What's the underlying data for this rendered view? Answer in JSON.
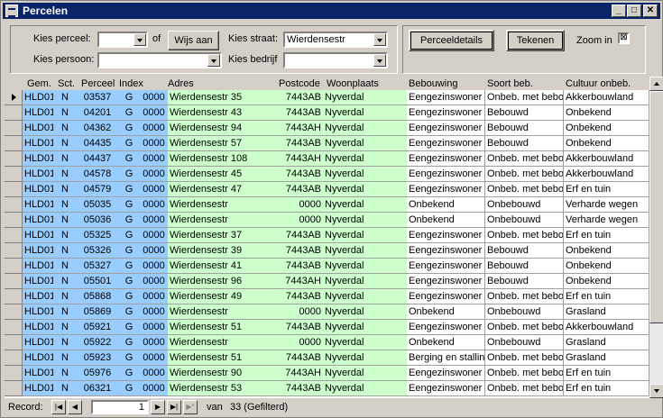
{
  "window": {
    "title": "Percelen"
  },
  "filters": {
    "perceel_label": "Kies perceel:",
    "perceel_value": "",
    "of_label": "of",
    "wijs_aan": "Wijs aan",
    "straat_label": "Kies straat:",
    "straat_value": "Wierdensestr",
    "persoon_label": "Kies persoon:",
    "persoon_value": "",
    "bedrijf_label": "Kies bedrijf",
    "bedrijf_value": ""
  },
  "actions": {
    "perceeldetails": "Perceeldetails",
    "tekenen": "Tekenen",
    "zoom_in_label": "Zoom in",
    "zoom_in_checked": "⊠"
  },
  "columns": [
    "Gem.",
    "Sct.",
    "Perceel",
    "Index",
    "Adres",
    "Postcode",
    "Woonplaats",
    "Bebouwing",
    "Soort beb.",
    "Cultuur onbeb."
  ],
  "rows": [
    [
      "HLD01",
      "N",
      "03537",
      "G",
      "0000",
      "Wierdensestr 35",
      "7443AB",
      "Nyverdal",
      "Eengezinswoner",
      "Onbeb. met bebo",
      "Akkerbouwland"
    ],
    [
      "HLD01",
      "N",
      "04201",
      "G",
      "0000",
      "Wierdensestr 43",
      "7443AB",
      "Nyverdal",
      "Eengezinswoner",
      "Bebouwd",
      "Onbekend"
    ],
    [
      "HLD01",
      "N",
      "04362",
      "G",
      "0000",
      "Wierdensestr 94",
      "7443AH",
      "Nyverdal",
      "Eengezinswoner",
      "Bebouwd",
      "Onbekend"
    ],
    [
      "HLD01",
      "N",
      "04435",
      "G",
      "0000",
      "Wierdensestr 57",
      "7443AB",
      "Nyverdal",
      "Eengezinswoner",
      "Bebouwd",
      "Onbekend"
    ],
    [
      "HLD01",
      "N",
      "04437",
      "G",
      "0000",
      "Wierdensestr 108",
      "7443AH",
      "Nyverdal",
      "Eengezinswoner",
      "Onbeb. met bebo",
      "Akkerbouwland"
    ],
    [
      "HLD01",
      "N",
      "04578",
      "G",
      "0000",
      "Wierdensestr 45",
      "7443AB",
      "Nyverdal",
      "Eengezinswoner",
      "Onbeb. met bebo",
      "Akkerbouwland"
    ],
    [
      "HLD01",
      "N",
      "04579",
      "G",
      "0000",
      "Wierdensestr 47",
      "7443AB",
      "Nyverdal",
      "Eengezinswoner",
      "Onbeb. met bebo",
      "Erf en tuin"
    ],
    [
      "HLD01",
      "N",
      "05035",
      "G",
      "0000",
      "Wierdensestr",
      "0000",
      "Nyverdal",
      "Onbekend",
      "Onbebouwd",
      "Verharde wegen"
    ],
    [
      "HLD01",
      "N",
      "05036",
      "G",
      "0000",
      "Wierdensestr",
      "0000",
      "Nyverdal",
      "Onbekend",
      "Onbebouwd",
      "Verharde wegen"
    ],
    [
      "HLD01",
      "N",
      "05325",
      "G",
      "0000",
      "Wierdensestr 37",
      "7443AB",
      "Nyverdal",
      "Eengezinswoner",
      "Onbeb. met bebo",
      "Erf en tuin"
    ],
    [
      "HLD01",
      "N",
      "05326",
      "G",
      "0000",
      "Wierdensestr 39",
      "7443AB",
      "Nyverdal",
      "Eengezinswoner",
      "Bebouwd",
      "Onbekend"
    ],
    [
      "HLD01",
      "N",
      "05327",
      "G",
      "0000",
      "Wierdensestr 41",
      "7443AB",
      "Nyverdal",
      "Eengezinswoner",
      "Bebouwd",
      "Onbekend"
    ],
    [
      "HLD01",
      "N",
      "05501",
      "G",
      "0000",
      "Wierdensestr 96",
      "7443AH",
      "Nyverdal",
      "Eengezinswoner",
      "Bebouwd",
      "Onbekend"
    ],
    [
      "HLD01",
      "N",
      "05868",
      "G",
      "0000",
      "Wierdensestr 49",
      "7443AB",
      "Nyverdal",
      "Eengezinswoner",
      "Onbeb. met bebo",
      "Erf en tuin"
    ],
    [
      "HLD01",
      "N",
      "05869",
      "G",
      "0000",
      "Wierdensestr",
      "0000",
      "Nyverdal",
      "Onbekend",
      "Onbebouwd",
      "Grasland"
    ],
    [
      "HLD01",
      "N",
      "05921",
      "G",
      "0000",
      "Wierdensestr 51",
      "7443AB",
      "Nyverdal",
      "Eengezinswoner",
      "Onbeb. met bebo",
      "Akkerbouwland"
    ],
    [
      "HLD01",
      "N",
      "05922",
      "G",
      "0000",
      "Wierdensestr",
      "0000",
      "Nyverdal",
      "Onbekend",
      "Onbebouwd",
      "Grasland"
    ],
    [
      "HLD01",
      "N",
      "05923",
      "G",
      "0000",
      "Wierdensestr 51",
      "7443AB",
      "Nyverdal",
      "Berging en stallin",
      "Onbeb. met bebo",
      "Grasland"
    ],
    [
      "HLD01",
      "N",
      "05976",
      "G",
      "0000",
      "Wierdensestr 90",
      "7443AH",
      "Nyverdal",
      "Eengezinswoner",
      "Onbeb. met bebo",
      "Erf en tuin"
    ],
    [
      "HLD01",
      "N",
      "06321",
      "G",
      "0000",
      "Wierdensestr 53",
      "7443AB",
      "Nyverdal",
      "Eengezinswoner",
      "Onbeb. met bebo",
      "Erf en tuin"
    ]
  ],
  "status": {
    "record_label": "Record:",
    "current": "1",
    "of_label": "van",
    "total": "33 (Gefilterd)"
  },
  "colors": {
    "blue": "#99ccff",
    "green": "#ccffcc",
    "titlebar": "#0a246a"
  }
}
